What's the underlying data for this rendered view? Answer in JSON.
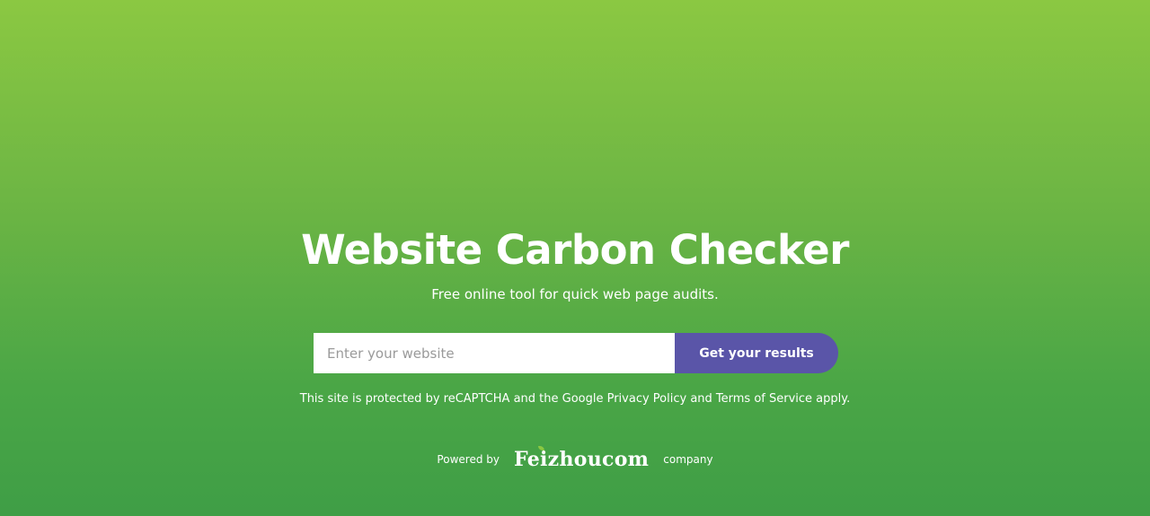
{
  "hero": {
    "title": "Website Carbon Checker",
    "subtitle": "Free online tool for quick web page audits."
  },
  "search": {
    "placeholder": "Enter your website",
    "value": "",
    "button_label": "Get your results"
  },
  "notice": "This site is protected by reCAPTCHA and the Google Privacy Policy and Terms of Service apply.",
  "footer": {
    "powered_label": "Powered by",
    "brand_name": "Feizhoucom",
    "company_label": "company"
  },
  "colors": {
    "gradient_top": "#8bc842",
    "gradient_bottom": "#3f9e46",
    "button": "#5a55a8",
    "text": "#ffffff"
  },
  "icons": {
    "brand_mark": "leaf-icon"
  }
}
